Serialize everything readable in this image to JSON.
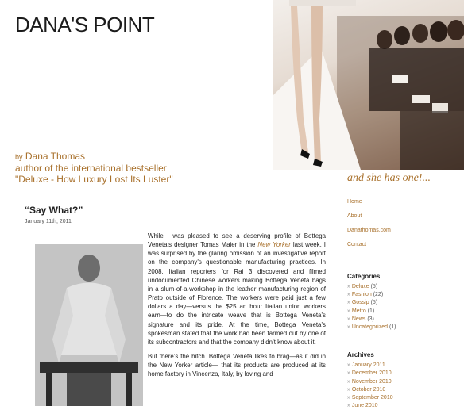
{
  "header": {
    "site_title": "DANA'S POINT",
    "byline_prefix": "by",
    "byline_name": "Dana Thomas",
    "byline_line2": "author of the international bestseller",
    "byline_line3": "\"Deluxe - How Luxury Lost Its Luster\"",
    "tagline": "and she has one!..."
  },
  "post": {
    "title": "“Say What?”",
    "date": "January 11th, 2011",
    "p1_a": "While I was pleased to see a deserving profile of Bottega Veneta’s designer Tomas Maier in the ",
    "p1_em": "New Yorker",
    "p1_b": " last week, I was surprised by the glaring omission of an investigative report on the company’s questionable manufacturing practices. In 2008, Italian reporters for Rai 3 discovered and filmed undocumented Chinese workers making Bottega Veneta bags in a slum-of-a-workshop in the leather manufacturing region of Prato outside of Florence. The workers were paid just a few dollars a day—versus the $25 an hour Italian union workers earn—to do the intricate weave that is Bottega Veneta’s signature and its pride. At the time, Bottega Veneta’s spokesman stated that the work had been farmed out by one of its subcontractors and that the company didn’t know about it.",
    "p2": "But there’s the hitch. Bottega Veneta likes to brag—as it did in the New Yorker article— that its products are produced at its home factory in Vincenza, Italy, by loving and"
  },
  "sidebar": {
    "nav": [
      "Home",
      "About",
      "Danathomas.com",
      "Contact"
    ],
    "categories_heading": "Categories",
    "categories": [
      {
        "name": "Deluxe",
        "count": "(5)"
      },
      {
        "name": "Fashion",
        "count": "(22)"
      },
      {
        "name": "Gossip",
        "count": "(5)"
      },
      {
        "name": "Metro",
        "count": "(1)"
      },
      {
        "name": "News",
        "count": "(3)"
      },
      {
        "name": "Uncategorized",
        "count": "(1)"
      }
    ],
    "archives_heading": "Archives",
    "archives": [
      "January 2011",
      "December 2010",
      "November 2010",
      "October 2010",
      "September 2010",
      "June 2010"
    ]
  }
}
